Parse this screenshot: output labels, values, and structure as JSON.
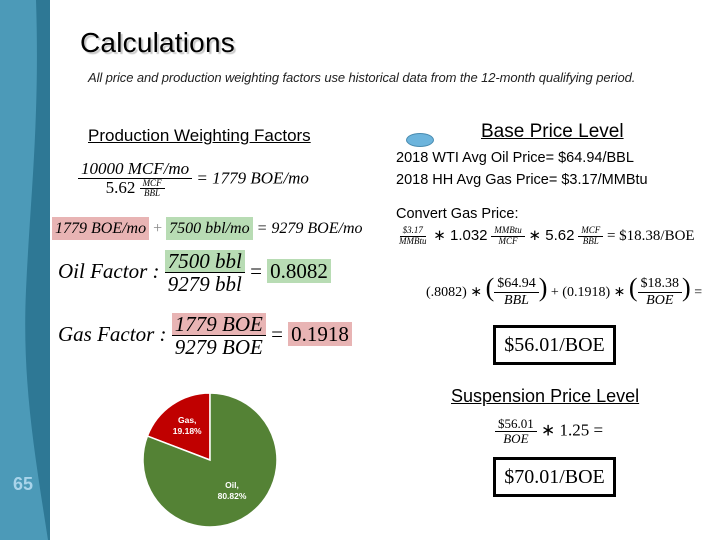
{
  "slide": {
    "title": "Calculations",
    "subtitle": "All price and production weighting factors use historical data from the 12-month qualifying period.",
    "slide_number": "65",
    "colors": {
      "sidebar": "#2e7895",
      "sidebar_light": "#4c9ab8",
      "gas_highlight": "#e8b4b4",
      "oil_highlight": "#b8dcb4",
      "pie_gas": "#c00000",
      "pie_oil": "#548235"
    }
  },
  "production": {
    "heading": "Production Weighting Factors",
    "eq1": {
      "num": "10000 MCF/mo",
      "den_value": "5.62",
      "den_unit_num": "MCF",
      "den_unit_den": "BBL",
      "result": "= 1779 BOE/mo"
    },
    "eq2": {
      "gas": "1779 BOE/mo",
      "plus": "+",
      "oil": "7500 bbl/mo",
      "result": "=  9279 BOE/mo"
    },
    "oil_factor": {
      "label": "Oil Factor :",
      "num": "7500 bbl",
      "den": "9279 bbl",
      "eq": "=",
      "value": "0.8082"
    },
    "gas_factor": {
      "label": "Gas Factor :",
      "num": "1779 BOE",
      "den": "9279 BOE",
      "eq": "=",
      "value": "0.1918"
    }
  },
  "base_price": {
    "heading": "Base Price Level",
    "oil_price_line": "2018 WTI Avg Oil Price= $64.94/BBL",
    "gas_price_line": "2018 HH Avg Gas Price= $3.17/MMBtu",
    "convert_label": "Convert Gas Price:",
    "convert_eq": {
      "f1_num": "$3.17",
      "f1_den": "MMBtu",
      "op1": "∗ 1.032",
      "f2_num": "MMBtu",
      "f2_den": "MCF",
      "op2": "∗ 5.62",
      "f3_num": "MCF",
      "f3_den": "BBL",
      "result": "= $18.38/BOE"
    },
    "weighted_eq": {
      "oil_w": "(.8082) ∗",
      "oil_num": "$64.94",
      "oil_den": "BBL",
      "plus": "+ (0.1918) ∗",
      "gas_num": "$18.38",
      "gas_den": "BOE",
      "eq": "="
    },
    "result": "$56.01/BOE"
  },
  "suspension_price": {
    "heading": "Suspension Price Level",
    "eq": {
      "num": "$56.01",
      "den": "BOE",
      "op": "∗ 1.25 ="
    },
    "result": "$70.01/BOE"
  },
  "chart_data": {
    "type": "pie",
    "title": "",
    "slices": [
      {
        "label": "Gas",
        "value": 19.18,
        "display": "Gas, 19.18%",
        "color": "#c00000"
      },
      {
        "label": "Oil",
        "value": 80.82,
        "display": "Oil, 80.82%",
        "color": "#548235"
      }
    ],
    "legend": "none"
  }
}
